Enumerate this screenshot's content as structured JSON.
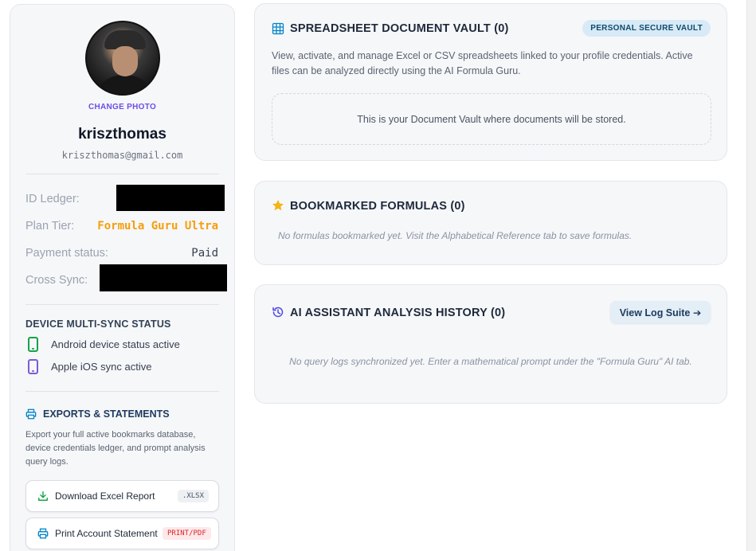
{
  "profile": {
    "change_photo": "CHANGE PHOTO",
    "username": "kriszthomas",
    "email": "kriszthomas@gmail.com",
    "avatar_icon": "user-avatar-photo"
  },
  "account": {
    "id_ledger_label": "ID Ledger:",
    "plan_tier_label": "Plan Tier:",
    "plan_tier_value": "Formula Guru Ultra",
    "payment_status_label": "Payment status:",
    "payment_status_value": "Paid",
    "cross_sync_label": "Cross Sync:",
    "plan_color": "#f59e0b"
  },
  "devices": {
    "title": "DEVICE MULTI-SYNC STATUS",
    "items": [
      {
        "label": "Android device status active",
        "icon": "android-phone-icon",
        "color": "#16a34a"
      },
      {
        "label": "Apple iOS sync active",
        "icon": "ios-phone-icon",
        "color": "#7c5cd6"
      }
    ]
  },
  "exports": {
    "title": "EXPORTS & STATEMENTS",
    "description": "Export your full active bookmarks database, device credentials ledger, and prompt analysis query logs.",
    "excel_label": "Download Excel Report",
    "excel_tag": ".XLSX",
    "print_label": "Print Account Statement",
    "print_tag": "PRINT/PDF"
  },
  "vault": {
    "title": "SPREADSHEET DOCUMENT VAULT (0)",
    "badge": "PERSONAL SECURE VAULT",
    "description": "View, activate, and manage Excel or CSV spreadsheets linked to your profile credentials. Active files can be analyzed directly using the AI Formula Guru.",
    "empty": "This is your Document Vault where documents will be stored."
  },
  "bookmarks": {
    "title": "BOOKMARKED FORMULAS (0)",
    "empty": "No formulas bookmarked yet. Visit the Alphabetical Reference tab to save formulas."
  },
  "history": {
    "title": "AI ASSISTANT ANALYSIS HISTORY (0)",
    "button": "View Log Suite ➔",
    "empty": "No query logs synchronized yet. Enter a mathematical prompt under the \"Formula Guru\" AI tab."
  }
}
